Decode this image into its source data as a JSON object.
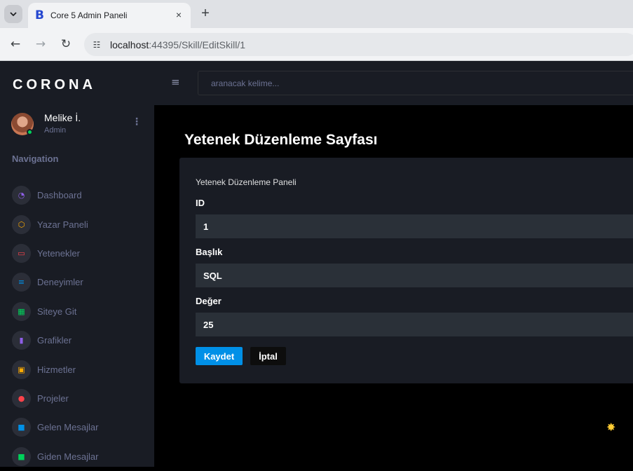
{
  "browser": {
    "tab_title": "Core 5 Admin Paneli",
    "favicon_letter": "B",
    "url_host": "localhost",
    "url_path": ":44395/Skill/EditSkill/1",
    "tab_menu_icon": "chevron-down-icon",
    "close_icon": "×",
    "new_tab_icon": "+",
    "back_icon": "←",
    "forward_icon": "→",
    "reload_icon": "↻",
    "site_info_icon": "☷"
  },
  "sidebar": {
    "brand": "CORONA",
    "profile": {
      "name": "Melike İ.",
      "role": "Admin",
      "more_icon": "⋮"
    },
    "nav_heading": "Navigation",
    "items": [
      {
        "label": "Dashboard",
        "icon": "speedometer-icon",
        "glyph": "◔",
        "color": "#8f5fe8"
      },
      {
        "label": "Yazar Paneli",
        "icon": "cube-icon",
        "glyph": "⬡",
        "color": "#ffab00"
      },
      {
        "label": "Yetenekler",
        "icon": "laptop-icon",
        "glyph": "▭",
        "color": "#fc424a"
      },
      {
        "label": "Deneyimler",
        "icon": "playlist-icon",
        "glyph": "≡",
        "color": "#0090e7"
      },
      {
        "label": "Siteye Git",
        "icon": "table-icon",
        "glyph": "▦",
        "color": "#00d25b"
      },
      {
        "label": "Grafikler",
        "icon": "chart-bar-icon",
        "glyph": "▮",
        "color": "#8f5fe8"
      },
      {
        "label": "Hizmetler",
        "icon": "contacts-icon",
        "glyph": "▣",
        "color": "#ffab00"
      },
      {
        "label": "Projeler",
        "icon": "github-icon",
        "glyph": "●",
        "color": "#fc424a"
      },
      {
        "label": "Gelen Mesajlar",
        "icon": "message-icon",
        "glyph": "■",
        "color": "#0090e7"
      },
      {
        "label": "Giden Mesajlar",
        "icon": "message-outgoing-icon",
        "glyph": "■",
        "color": "#00d25b"
      }
    ]
  },
  "topbar": {
    "menu_icon": "≡",
    "search_placeholder": "aranacak kelime..."
  },
  "main": {
    "page_title": "Yetenek Düzenleme Sayfası",
    "card_title": "Yetenek Düzenleme Paneli",
    "fields": [
      {
        "label": "ID",
        "value": "1"
      },
      {
        "label": "Başlık",
        "value": "SQL"
      },
      {
        "label": "Değer",
        "value": "25"
      }
    ],
    "save_label": "Kaydet",
    "cancel_label": "İptal"
  }
}
